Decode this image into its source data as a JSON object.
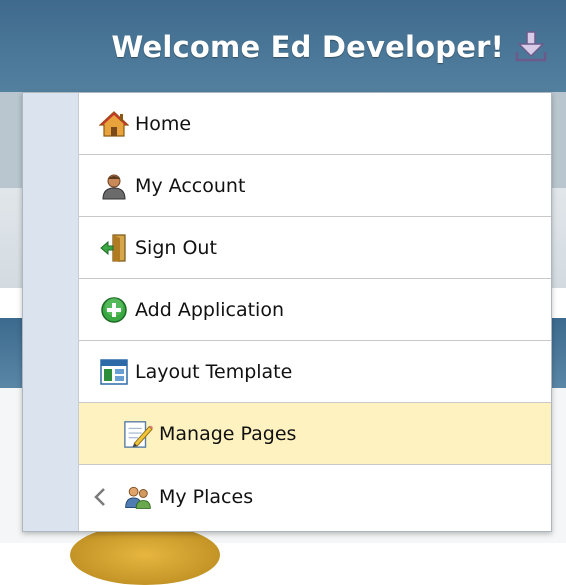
{
  "header": {
    "welcome_text": "Welcome Ed Developer!",
    "download_icon": "download-icon"
  },
  "menu": {
    "items": [
      {
        "label": "Home",
        "icon": "home-icon"
      },
      {
        "label": "My Account",
        "icon": "user-icon"
      },
      {
        "label": "Sign Out",
        "icon": "door-exit-icon"
      },
      {
        "label": "Add Application",
        "icon": "add-circle-icon"
      },
      {
        "label": "Layout Template",
        "icon": "layout-template-icon"
      },
      {
        "label": "Manage Pages",
        "icon": "edit-page-icon",
        "highlighted": true
      },
      {
        "label": "My Places",
        "icon": "people-icon",
        "has_submenu": true
      }
    ]
  },
  "colors": {
    "header_bg": "#4a7699",
    "menu_gutter": "#dbe3ee",
    "highlight_bg": "#fdf2c0",
    "add_green": "#3aa843"
  }
}
